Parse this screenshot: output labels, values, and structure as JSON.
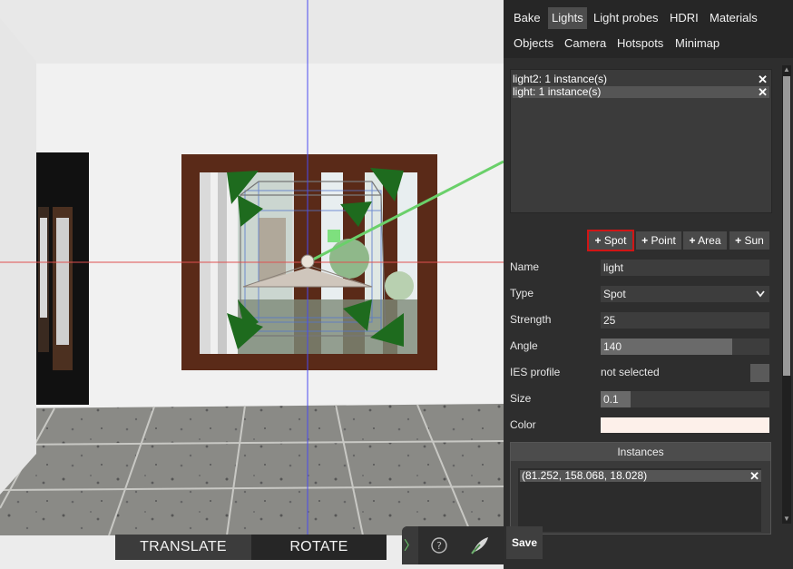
{
  "tabs": [
    "Bake",
    "Lights",
    "Light probes",
    "HDRI",
    "Materials",
    "Objects",
    "Camera",
    "Hotspots",
    "Minimap"
  ],
  "active_tab": "Lights",
  "lights": [
    {
      "label": "light2: 1 instance(s)",
      "selected": false
    },
    {
      "label": "light: 1 instance(s)",
      "selected": true
    }
  ],
  "add_buttons": {
    "spot": "Spot",
    "point": "Point",
    "area": "Area",
    "sun": "Sun",
    "plus": "+"
  },
  "props": {
    "name_label": "Name",
    "name_value": "light",
    "type_label": "Type",
    "type_value": "Spot",
    "strength_label": "Strength",
    "strength_value": "25",
    "angle_label": "Angle",
    "angle_value": "140",
    "angle_fraction": 0.78,
    "ies_label": "IES profile",
    "ies_value": "not selected",
    "size_label": "Size",
    "size_value": "0.1",
    "size_fraction": 0.18,
    "color_label": "Color",
    "color_value": "#fdf0ea"
  },
  "instances": {
    "title": "Instances",
    "items": [
      "(81.252, 158.068, 18.028)"
    ]
  },
  "save_label": "Save",
  "modes": {
    "translate": "TRANSLATE",
    "rotate": "ROTATE"
  },
  "tools": {
    "expand_glyph": "〉",
    "help_glyph": "?"
  },
  "icons": {
    "close": "✕",
    "help": "help-circle-icon",
    "paint": "feather-brush-icon",
    "expand": "chevron-right-icon",
    "dropdown": "chevron-down-icon"
  },
  "colors": {
    "highlight_outline": "#d01515",
    "gizmo_green": "#1e6b1e",
    "axis_red": "#d04040",
    "axis_blue": "#4040d0"
  }
}
